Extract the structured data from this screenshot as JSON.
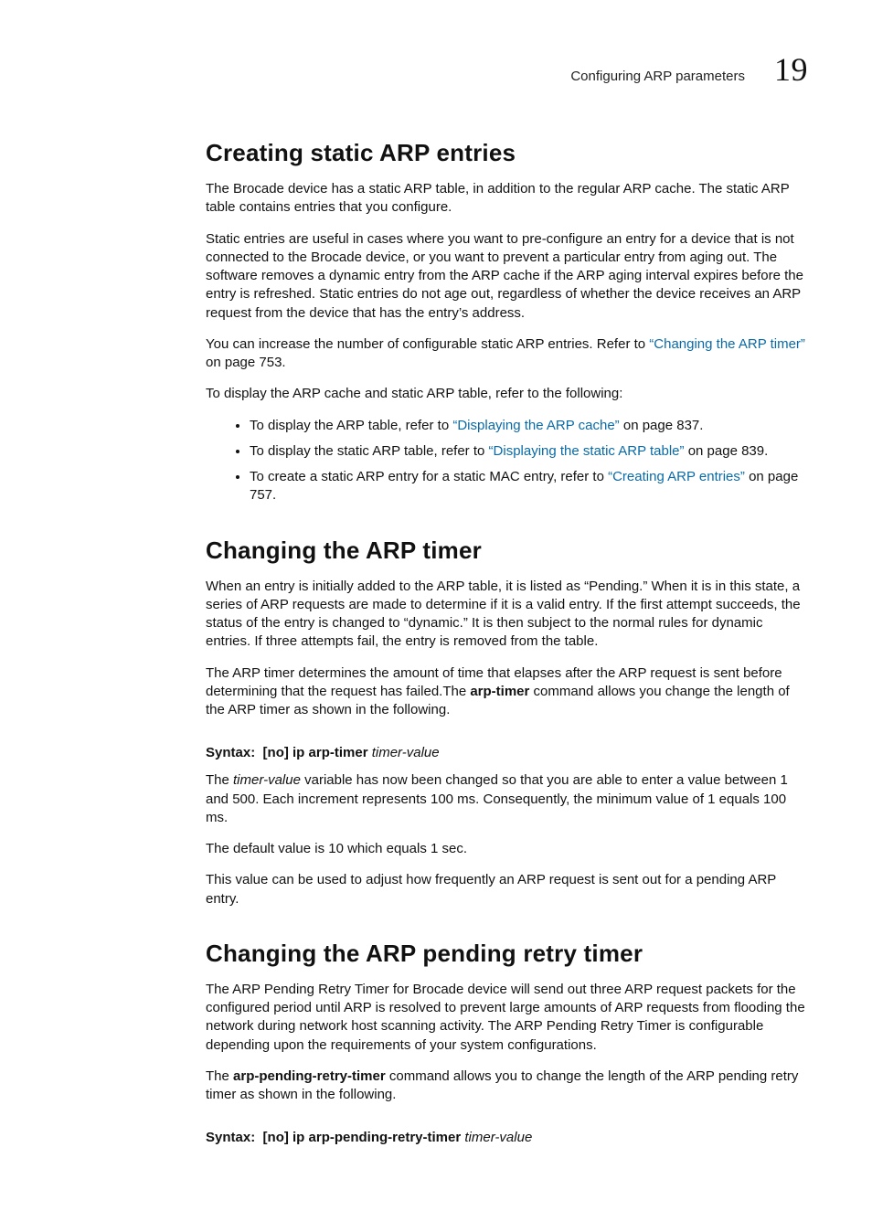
{
  "header": {
    "running_title": "Configuring ARP parameters",
    "chapter_number": "19"
  },
  "sec1": {
    "heading": "Creating static ARP entries",
    "p1": "The Brocade device has a static ARP table, in addition to the regular ARP cache. The static ARP table contains entries that you configure.",
    "p2": "Static entries are useful in cases where you want to pre-configure an entry for a device that is not connected to the Brocade device, or you want to prevent a particular entry from aging out. The software removes a dynamic entry from the ARP cache if the ARP aging interval expires before the entry is refreshed. Static entries do not age out, regardless of whether the device receives an ARP request from the device that has the entry’s address.",
    "p3a": "You can increase the number of configurable static ARP entries. Refer to ",
    "p3_link": "“Changing the ARP timer”",
    "p3b": " on page 753.",
    "p4": "To display the ARP cache and static ARP table, refer to the following:",
    "bul1a": "To display the ARP table, refer to ",
    "bul1_link": "“Displaying the ARP cache”",
    "bul1b": " on page 837.",
    "bul2a": "To display the static ARP table, refer to ",
    "bul2_link": "“Displaying the static ARP table”",
    "bul2b": " on page 839.",
    "bul3a": "To create a static ARP entry for a static MAC entry, refer to ",
    "bul3_link": "“Creating ARP entries”",
    "bul3b": " on page 757."
  },
  "sec2": {
    "heading": "Changing the ARP timer",
    "p1": "When an entry is initially added to the ARP table, it is listed as “Pending.” When it is in this state, a series of ARP requests are made to determine if it is a valid entry. If the first attempt succeeds, the status of the entry is changed to “dynamic.” It is then subject to the normal rules for dynamic entries. If three attempts fail, the entry is removed from the table.",
    "p2a": "The ARP timer determines the amount of time that elapses after the ARP request is sent before determining that the request has failed.The ",
    "p2_cmd": "arp-timer",
    "p2b": " command allows you change the length of the ARP timer as shown in the following.",
    "syntax_label": "Syntax:",
    "syntax_body": "[no] ip arp-timer",
    "syntax_var": "timer-value",
    "p3a": "The ",
    "p3_var": "timer-value",
    "p3b": " variable has now been changed so that you are able to enter a value between 1 and 500. Each increment represents 100 ms. Consequently, the minimum value of 1 equals 100 ms.",
    "p4": "The default value is 10 which equals 1 sec.",
    "p5": "This value can be used to adjust how frequently an ARP request is sent out for a pending ARP entry."
  },
  "sec3": {
    "heading": "Changing the ARP pending retry timer",
    "p1": "The ARP Pending Retry Timer for Brocade device will send out three ARP request packets for the configured period until ARP is resolved to prevent large amounts of ARP requests from flooding the network during network host scanning activity. The ARP Pending Retry Timer is configurable depending upon the requirements of your system configurations.",
    "p2a": "The ",
    "p2_cmd": "arp-pending-retry-timer",
    "p2b": " command allows you to change the length of the ARP pending retry timer as shown in the following.",
    "syntax_label": "Syntax:",
    "syntax_body": "[no] ip arp-pending-retry-timer",
    "syntax_var": "timer-value"
  }
}
